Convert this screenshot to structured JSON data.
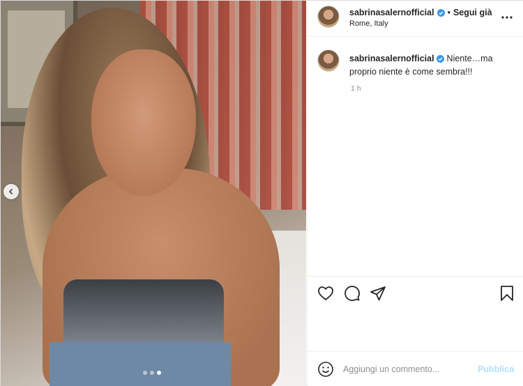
{
  "header": {
    "username": "sabrinasalernofficial",
    "separator": "•",
    "follow_label": "Segui già",
    "location": "Rome, Italy",
    "more_icon": "more-horizontal-icon"
  },
  "caption": {
    "username": "sabrinasalernofficial",
    "text": "Niente…ma proprio niente è come sembra!!!",
    "time": "1 h"
  },
  "actions": {
    "like_icon": "heart-icon",
    "comment_icon": "comment-icon",
    "share_icon": "share-icon",
    "save_icon": "bookmark-icon"
  },
  "add_comment": {
    "placeholder": "Aggiungi un commento...",
    "publish_label": "Pubblica"
  },
  "carousel": {
    "slide_count": 3,
    "active_slide": 3
  },
  "colors": {
    "verified": "#3897f0",
    "publish_disabled": "#b2dffc",
    "muted_text": "#8e8e8e"
  }
}
